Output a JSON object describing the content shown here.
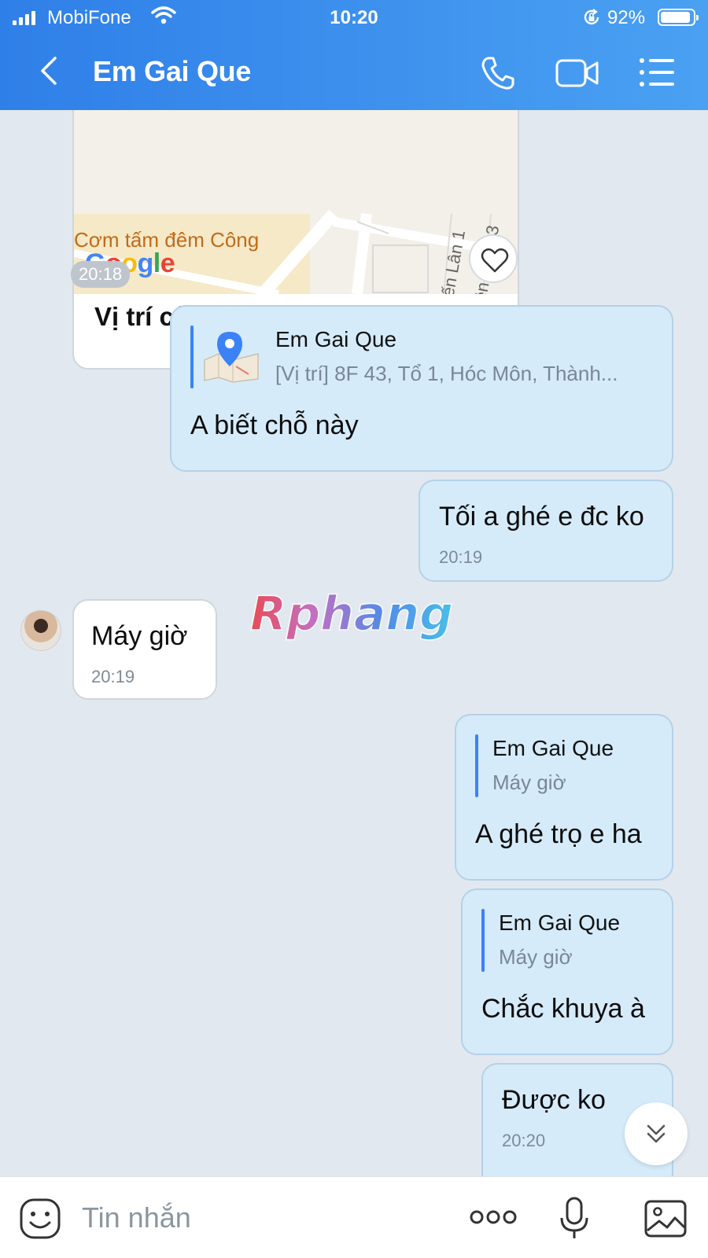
{
  "status": {
    "carrier": "MobiFone",
    "time": "10:20",
    "battery_percent": "92%",
    "battery_level": 0.92
  },
  "header": {
    "title": "Em Gai Que",
    "back_icon": "chevron-left-icon",
    "call_icon": "phone-icon",
    "video_icon": "video-camera-icon",
    "menu_icon": "list-menu-icon"
  },
  "messages": {
    "location_card": {
      "map_place": "Cơm tấm đêm Công",
      "map_brand": "Google",
      "road_1": "ến Lân 1",
      "road_2": "ền Lân 13",
      "title": "Vị trí của Em Gai Que",
      "time": "20:18"
    },
    "reply_location": {
      "reply_name": "Em Gai Que",
      "reply_snippet": "[Vị trí] 8F 43, Tổ 1, Hóc Môn, Thành...",
      "text": "A biết chỗ này"
    },
    "msg_toi": {
      "text": "Tối a ghé e đc ko",
      "time": "20:19"
    },
    "msg_may_gio": {
      "text": "Máy giờ",
      "time": "20:19"
    },
    "watermark": "Rphang",
    "reply_ghe_tro": {
      "reply_name": "Em Gai Que",
      "reply_snippet": "Máy giờ",
      "text": "A ghé trọ e ha"
    },
    "reply_khuya": {
      "reply_name": "Em Gai Que",
      "reply_snippet": "Máy giờ",
      "text": "Chắc khuya à"
    },
    "msg_duoc_ko": {
      "text": "Được ko",
      "time": "20:20"
    }
  },
  "input_bar": {
    "placeholder": "Tin nhắn",
    "emoji_icon": "sticker-smile-icon",
    "more_icon": "more-dots-icon",
    "mic_icon": "microphone-icon",
    "gallery_icon": "image-gallery-icon"
  },
  "colors": {
    "header_start": "#2f7fe8",
    "header_end": "#4aa1f2",
    "chat_background": "#e2e8f0",
    "outgoing_bubble": "#d5ebfa",
    "incoming_bubble": "#ffffff",
    "reply_accent": "#3b82f6"
  }
}
